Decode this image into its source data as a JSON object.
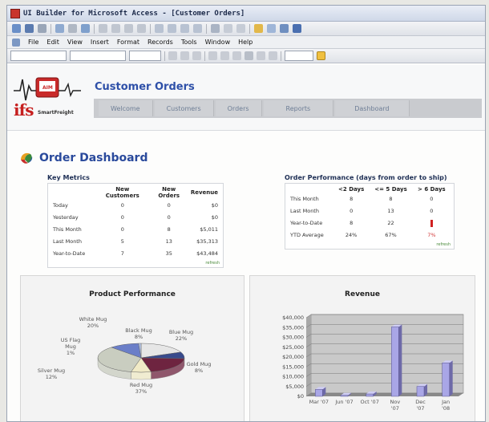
{
  "window": {
    "title": "UI Builder for Microsoft Access - [Customer Orders]"
  },
  "menubar": {
    "items": [
      "File",
      "Edit",
      "View",
      "Insert",
      "Format",
      "Records",
      "Tools",
      "Window",
      "Help"
    ]
  },
  "app": {
    "title": "Customer Orders",
    "logo_text": "ifs",
    "logo_subtext": "SmartFreight",
    "nav": [
      "Welcome",
      "Customers",
      "Orders",
      "Reports",
      "Dashboard"
    ]
  },
  "dashboard": {
    "title": "Order Dashboard"
  },
  "key_metrics": {
    "title": "Key Metrics",
    "headers": [
      "",
      "New Customers",
      "New Orders",
      "Revenue"
    ],
    "rows": [
      [
        "Today",
        "0",
        "0",
        "$0"
      ],
      [
        "Yesterday",
        "0",
        "0",
        "$0"
      ],
      [
        "This Month",
        "0",
        "8",
        "$5,011"
      ],
      [
        "Last Month",
        "5",
        "13",
        "$35,313"
      ],
      [
        "Year-to-Date",
        "7",
        "35",
        "$43,484"
      ]
    ],
    "refresh_label": "refresh"
  },
  "order_performance": {
    "title": "Order Performance  (days from order to ship)",
    "headers": [
      "",
      "<2 Days",
      "<= 5 Days",
      "> 6 Days"
    ],
    "rows": [
      [
        "This Month",
        "8",
        "8",
        "0"
      ],
      [
        "Last Month",
        "0",
        "13",
        "0"
      ],
      [
        "Year-to-Date",
        "8",
        "22",
        ""
      ],
      [
        "YTD Average",
        "24%",
        "67%",
        "7%"
      ]
    ],
    "refresh_label": "refresh"
  },
  "colors": {
    "accent": "#2e50a8",
    "alert": "#d02020",
    "bar": "#a9a6e6"
  },
  "chart_data": [
    {
      "type": "pie",
      "title": "Product Performance",
      "labels": [
        "White Mug",
        "Black Mug",
        "Blue Mug",
        "Gold Mug",
        "Red Mug",
        "Silver Mug",
        "US Flag Mug"
      ],
      "values": [
        20,
        8,
        22,
        8,
        37,
        12,
        1
      ],
      "label_texts": [
        "White Mug\n20%",
        "Black Mug\n8%",
        "Blue Mug\n22%",
        "Gold Mug\n8%",
        "Red Mug\n37%",
        "Silver Mug\n12%",
        "US Flag\nMug\n1%"
      ],
      "colors": [
        "#e6e6e6",
        "#384a8c",
        "#6e2440",
        "#f0eac6",
        "#c9cdc0",
        "#6a7ec8",
        "#b8c8e8"
      ]
    },
    {
      "type": "bar",
      "title": "Revenue",
      "categories": [
        "Mar '07",
        "Jun '07",
        "Oct '07",
        "Nov '07",
        "Dec '07",
        "Jan '08"
      ],
      "values": [
        3500,
        500,
        1200,
        35313,
        5011,
        17000
      ],
      "ylim": [
        0,
        40000
      ],
      "yticks": [
        "$0",
        "$5,000",
        "$10,000",
        "$15,000",
        "$20,000",
        "$25,000",
        "$30,000",
        "$35,000",
        "$40,000"
      ],
      "grid": true
    }
  ]
}
